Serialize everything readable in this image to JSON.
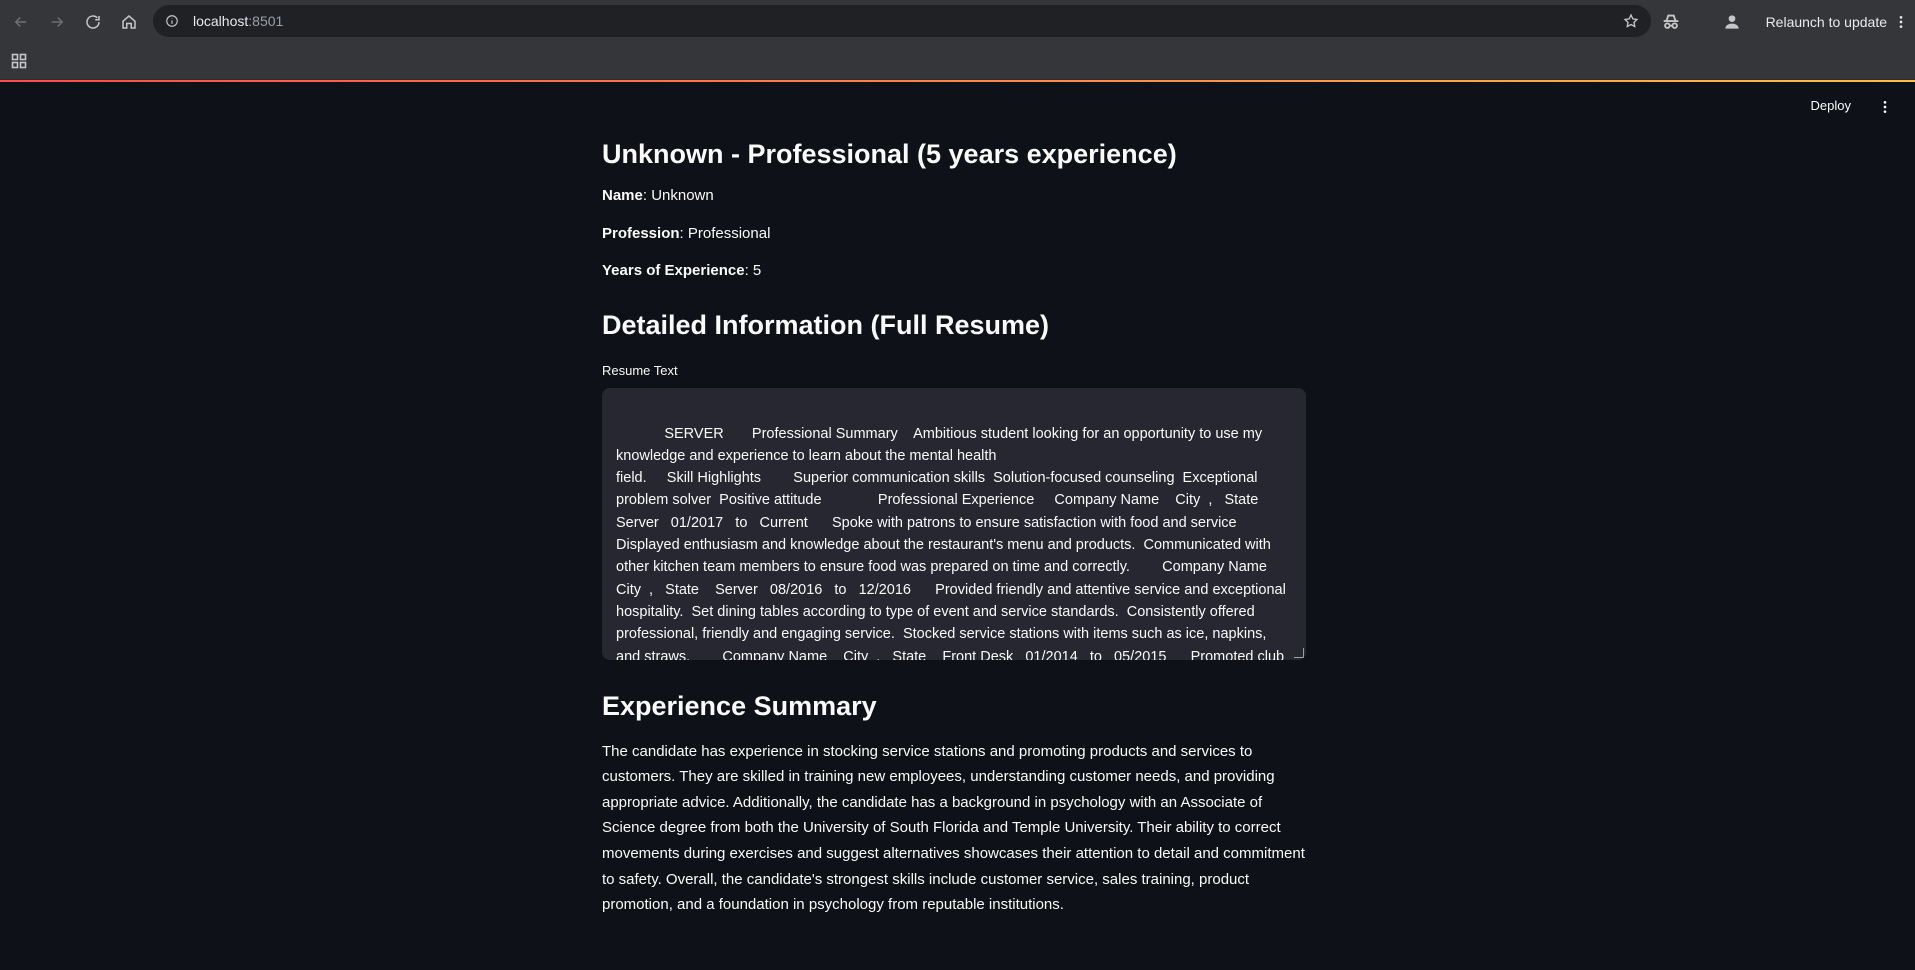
{
  "browser": {
    "url_host": "localhost",
    "url_port": ":8501",
    "relaunch_label": "Relaunch to update"
  },
  "app": {
    "deploy_label": "Deploy"
  },
  "page": {
    "title": "Unknown - Professional (5 years experience)",
    "name_label": "Name",
    "name_value": ": Unknown",
    "profession_label": "Profession",
    "profession_value": ": Professional",
    "years_label": "Years of Experience",
    "years_value": ": 5",
    "detail_heading": "Detailed Information (Full Resume)",
    "resume_label": "Resume Text",
    "resume_text": "      SERVER       Professional Summary    Ambitious student looking for an opportunity to use my knowledge and experience to learn about the mental health\nfield.     Skill Highlights        Superior communication skills  Solution-focused counseling  Exceptional problem solver  Positive attitude              Professional Experience     Company Name    City  ,   State    Server   01/2017   to   Current      Spoke with patrons to ensure satisfaction with food and service     Displayed enthusiasm and knowledge about the restaurant's menu and products.  Communicated with other kitchen team members to ensure food was prepared on time and correctly.        Company Name    City  ,   State    Server   08/2016   to   12/2016      Provided friendly and attentive service and exceptional hospitality.  Set dining tables according to type of event and service standards.  Consistently offered professional, friendly and engaging service.  Stocked service stations with items such as ice, napkins, and straws.        Company Name    City  ,   State    Front Desk   01/2014   to   05/2015      Promoted club programs, products and services to participants.    Trained all new sales",
    "exp_heading": "Experience Summary",
    "exp_summary": "The candidate has experience in stocking service stations and promoting products and services to customers. They are skilled in training new employees, understanding customer needs, and providing appropriate advice. Additionally, the candidate has a background in psychology with an Associate of Science degree from both the University of South Florida and Temple University. Their ability to correct movements during exercises and suggest alternatives showcases their attention to detail and commitment to safety. Overall, the candidate's strongest skills include customer service, sales training, product promotion, and a foundation in psychology from reputable institutions."
  },
  "colors": {
    "background": "#0e1117",
    "chrome": "#35363a",
    "textarea_bg": "#262730",
    "accent_start": "#ff4b4b",
    "accent_end": "#ffbd45"
  }
}
